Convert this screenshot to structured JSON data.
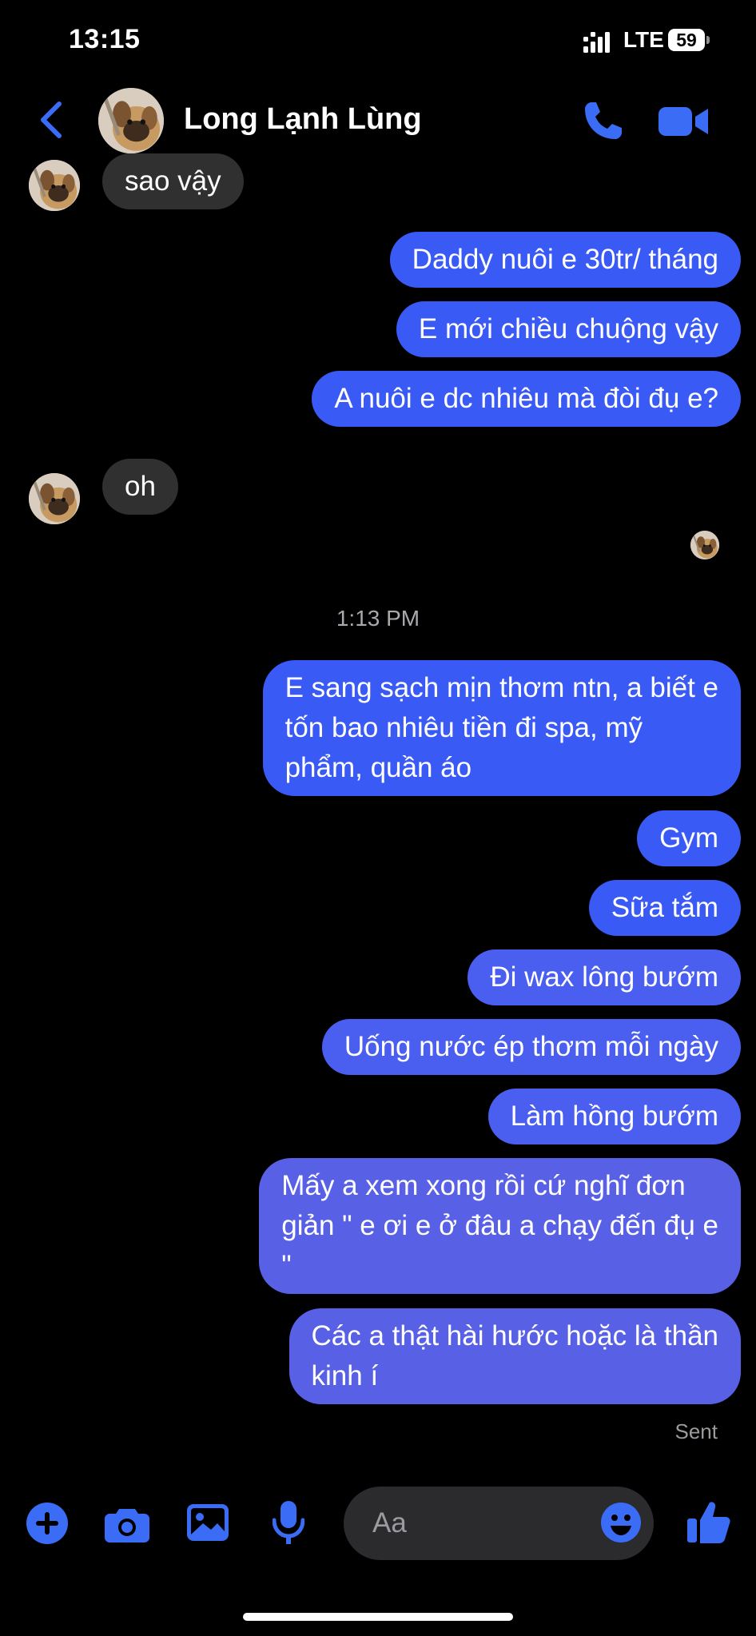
{
  "status_bar": {
    "time": "13:15",
    "carrier": "LTE",
    "battery": "59"
  },
  "header": {
    "contact_name": "Long Lạnh Lùng",
    "icons": {
      "back": "chevron-left-icon",
      "call": "phone-icon",
      "video": "video-camera-icon"
    }
  },
  "messages": [
    {
      "from": "them",
      "text": "sao vậy"
    },
    {
      "from": "me",
      "text": "Daddy nuôi e 30tr/ tháng"
    },
    {
      "from": "me",
      "text": "E mới chiều chuộng vậy"
    },
    {
      "from": "me",
      "text": "A nuôi e dc nhiêu mà đòi đụ e?"
    },
    {
      "from": "them",
      "text": "oh"
    },
    {
      "from": "me",
      "text": "E sang sạch mịn thơm ntn, a biết e\ntốn bao nhiêu tiền đi spa, mỹ\nphẩm, quần áo"
    },
    {
      "from": "me",
      "text": "Gym"
    },
    {
      "from": "me",
      "text": "Sữa tắm"
    },
    {
      "from": "me",
      "text": "Đi wax lông bướm"
    },
    {
      "from": "me",
      "text": "Uống nước ép thơm mỗi ngày"
    },
    {
      "from": "me",
      "text": "Làm hồng bướm"
    },
    {
      "from": "me",
      "text": "Mấy a xem xong rồi cứ nghĩ đơn\ngiản \" e ơi e ở đâu a chạy đến đụ e\n\""
    },
    {
      "from": "me",
      "text": "Các a thật hài hước hoặc là thần\nkinh í"
    }
  ],
  "timestamp": "1:13 PM",
  "delivery_status": "Sent",
  "composer": {
    "placeholder": "Aa",
    "icons": [
      "plus-icon",
      "camera-icon",
      "photo-icon",
      "microphone-icon",
      "emoji-icon",
      "thumbs-up-icon"
    ]
  },
  "colors": {
    "accent": "#3a5af5",
    "incoming_bubble": "#303030",
    "background": "#000000"
  }
}
